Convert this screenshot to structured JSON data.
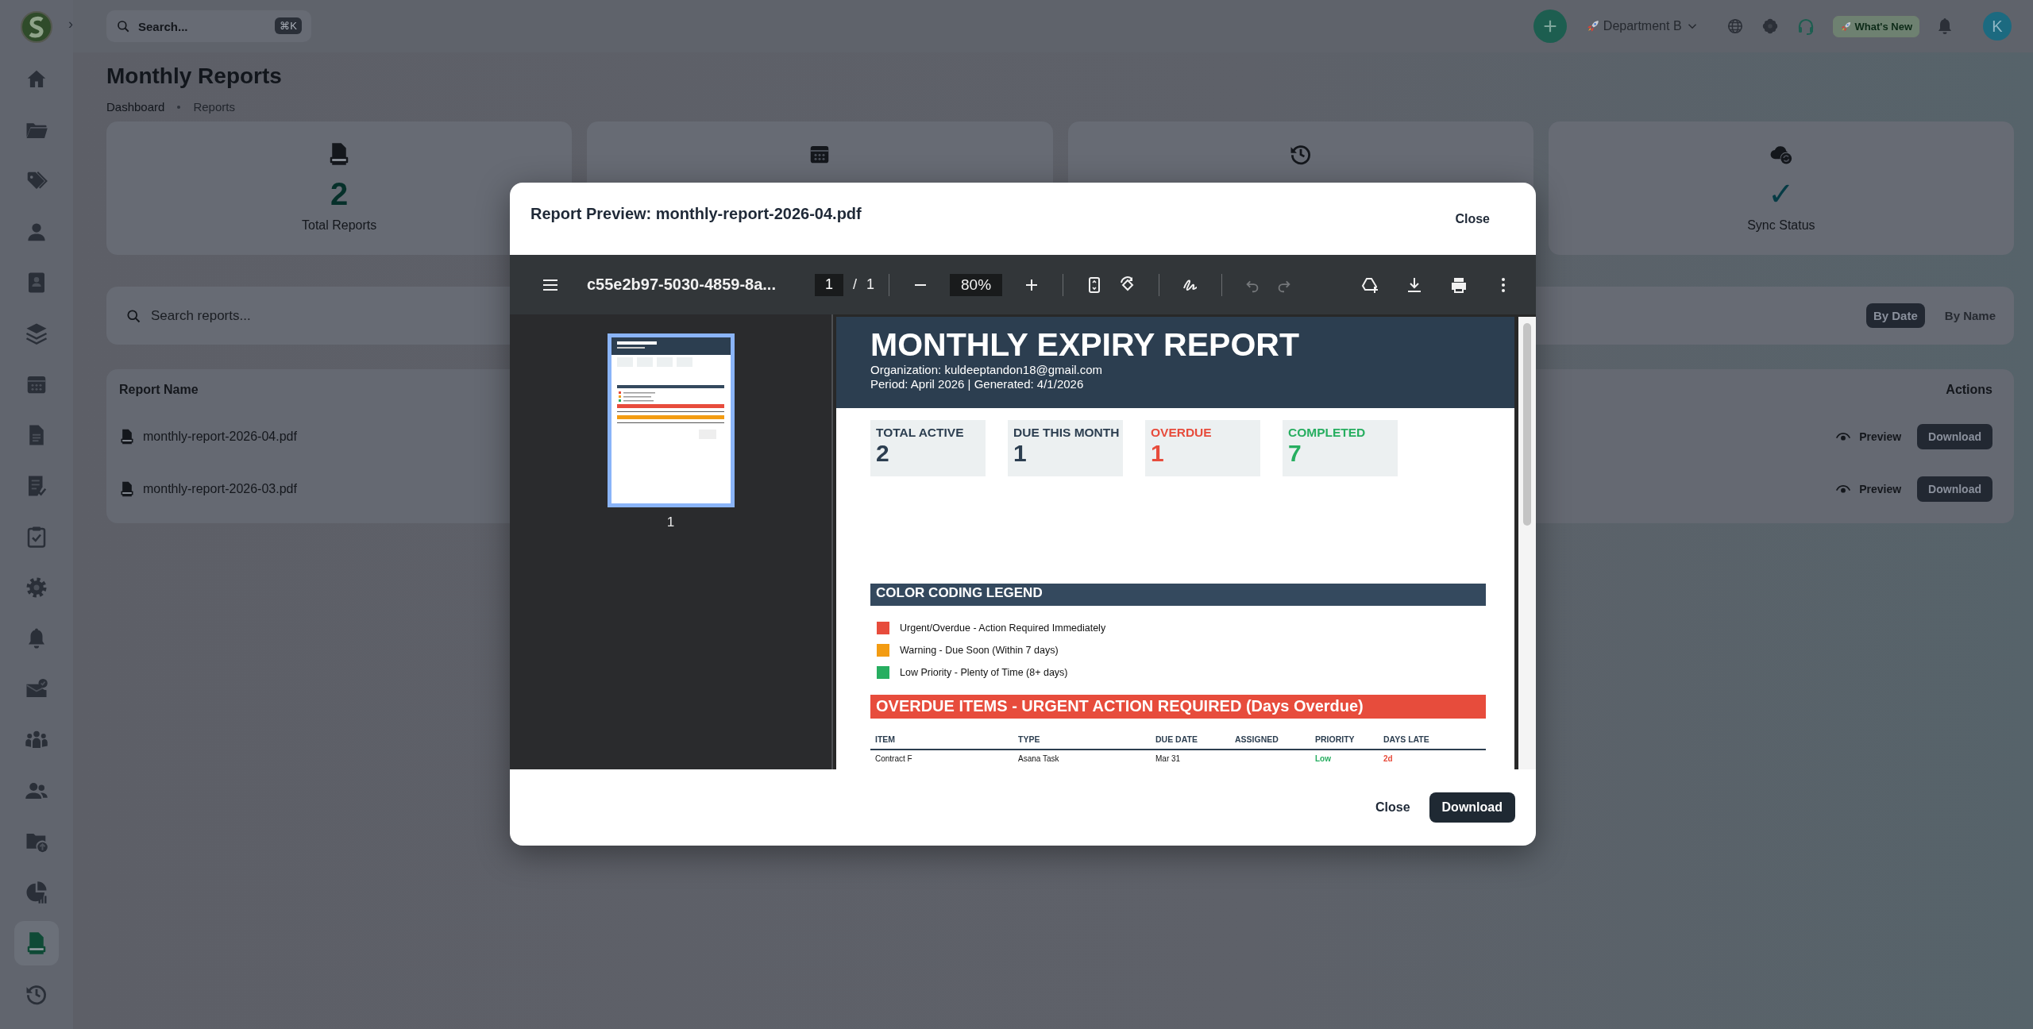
{
  "topbar": {
    "search": {
      "placeholder": "Search...",
      "shortcut": "⌘K"
    },
    "department": "Department B",
    "whats_new": "What's New",
    "avatar": "K"
  },
  "sidebar": {
    "expand": "›",
    "items": [
      {
        "selected": false
      },
      {
        "selected": false
      },
      {
        "selected": false
      },
      {
        "selected": false
      },
      {
        "selected": false
      },
      {
        "selected": false
      },
      {
        "selected": false
      },
      {
        "selected": false
      },
      {
        "selected": false
      },
      {
        "selected": false
      },
      {
        "selected": false
      },
      {
        "selected": false
      },
      {
        "selected": false
      },
      {
        "selected": false
      },
      {
        "selected": false
      },
      {
        "selected": false
      },
      {
        "selected": false
      },
      {
        "selected": true
      },
      {
        "selected": false
      }
    ]
  },
  "page": {
    "title": "Monthly Reports",
    "breadcrumb": [
      "Dashboard",
      "Reports"
    ]
  },
  "stats": [
    {
      "value": "2",
      "label": "Total Reports"
    },
    {
      "value": "✓",
      "label": "Sync Status"
    }
  ],
  "filters": {
    "search_placeholder": "Search reports...",
    "sort": [
      {
        "label": "By Date",
        "selected": true
      },
      {
        "label": "By Name",
        "selected": false
      }
    ]
  },
  "reports": {
    "columns": [
      "Report Name",
      "Actions"
    ],
    "rows": [
      {
        "name": "monthly-report-2026-04.pdf",
        "preview": "Preview",
        "download": "Download"
      },
      {
        "name": "monthly-report-2026-03.pdf",
        "preview": "Preview",
        "download": "Download"
      }
    ]
  },
  "modal": {
    "title": "Report Preview: monthly-report-2026-04.pdf",
    "close": "Close",
    "viewer": {
      "file_name": "c55e2b97-5030-4859-8a...",
      "page": "1",
      "page_separator": "/",
      "page_count": "1",
      "zoom": "80%",
      "undo_disabled": true,
      "redo_disabled": true,
      "thumbnails": [
        {
          "label": "1",
          "selected": true
        }
      ]
    },
    "report": {
      "title": "MONTHLY EXPIRY REPORT",
      "organization": "Organization: kuldeeptandon18@gmail.com",
      "period": "Period: April 2026 | Generated: 4/1/2026",
      "stats": [
        {
          "label": "TOTAL ACTIVE",
          "value": "2",
          "color": "#2c3e50"
        },
        {
          "label": "DUE THIS MONTH",
          "value": "1",
          "color": "#2c3e50"
        },
        {
          "label": "OVERDUE",
          "value": "1",
          "color": "#e74c3c"
        },
        {
          "label": "COMPLETED",
          "value": "7",
          "color": "#27ae60"
        }
      ],
      "legend_title": "COLOR CODING LEGEND",
      "legend": [
        {
          "label": "Urgent/Overdue - Action Required Immediately",
          "color": "#e74c3c"
        },
        {
          "label": "Warning - Due Soon (Within 7 days)",
          "color": "#f39c12"
        },
        {
          "label": "Low Priority - Plenty of Time (8+ days)",
          "color": "#27ae60"
        }
      ],
      "overdue_title": "OVERDUE ITEMS - URGENT ACTION REQUIRED (Days Overdue)",
      "overdue_table": {
        "columns": [
          "ITEM",
          "TYPE",
          "DUE DATE",
          "ASSIGNED",
          "PRIORITY",
          "DAYS LATE"
        ],
        "rows": [
          {
            "item": "Contract F",
            "type": "Asana Task",
            "due_date": "Mar 31",
            "priority": "Low",
            "color": "#27ae60",
            "days_late": "2d"
          }
        ]
      }
    },
    "footer": {
      "close": "Close",
      "download": "Download"
    }
  }
}
